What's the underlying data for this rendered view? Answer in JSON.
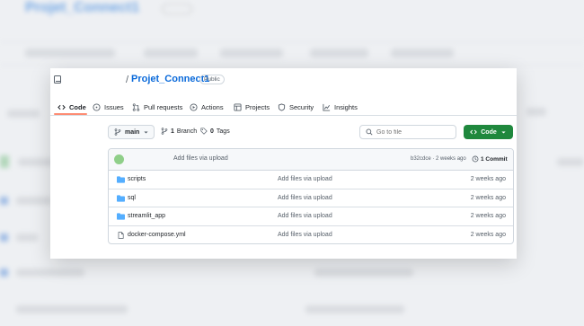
{
  "backdrop": {
    "title": "Projet_Connect1"
  },
  "repo": {
    "slash": "/",
    "name": "Projet_Connect1",
    "visibility": "Public"
  },
  "tabs": [
    {
      "label": "Code",
      "icon": "code-icon",
      "active": true
    },
    {
      "label": "Issues",
      "icon": "issue-icon"
    },
    {
      "label": "Pull requests",
      "icon": "pull-request-icon"
    },
    {
      "label": "Actions",
      "icon": "play-icon"
    },
    {
      "label": "Projects",
      "icon": "table-icon"
    },
    {
      "label": "Security",
      "icon": "shield-icon"
    },
    {
      "label": "Insights",
      "icon": "graph-icon"
    }
  ],
  "controls": {
    "branch": "main",
    "branch_count": "1",
    "branch_label": "Branch",
    "tag_count": "0",
    "tag_label": "Tags",
    "search_placeholder": "Go to file",
    "code_button": "Code"
  },
  "commit": {
    "message": "Add files via upload",
    "meta": "b32cdce · 2 weeks ago",
    "count": "1 Commit"
  },
  "files": [
    {
      "name": "scripts",
      "type": "dir",
      "message": "Add files via upload",
      "time": "2 weeks ago"
    },
    {
      "name": "sql",
      "type": "dir",
      "message": "Add files via upload",
      "time": "2 weeks ago"
    },
    {
      "name": "streamlit_app",
      "type": "dir",
      "message": "Add files via upload",
      "time": "2 weeks ago"
    },
    {
      "name": "docker-compose.yml",
      "type": "file",
      "message": "Add files via upload",
      "time": "2 weeks ago"
    }
  ],
  "colors": {
    "accent": "#0969da",
    "code_button": "#1f883d",
    "active_tab_underline": "#fd8c73",
    "folder": "#54aeff"
  }
}
